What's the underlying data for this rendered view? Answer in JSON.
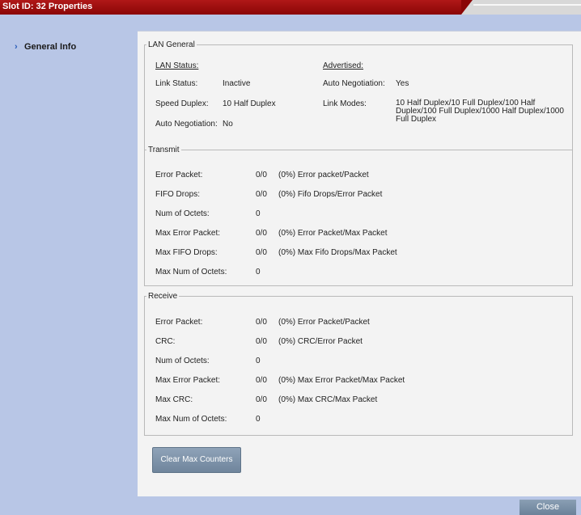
{
  "title": "Slot ID: 32 Properties",
  "nav": {
    "general_info": "General Info"
  },
  "lan_general": {
    "legend": "LAN General",
    "lan_status_header": "LAN Status:",
    "advertised_header": "Advertised:",
    "link_status_label": "Link Status:",
    "link_status_value": "Inactive",
    "speed_duplex_label": "Speed Duplex:",
    "speed_duplex_value": "10 Half Duplex",
    "auto_neg_label": "Auto Negotiation:",
    "auto_neg_value": "No",
    "adv_auto_neg_label": "Auto Negotiation:",
    "adv_auto_neg_value": "Yes",
    "link_modes_label": "Link Modes:",
    "link_modes_value": [
      "10 Half Duplex/10 Full Duplex/100 Half",
      "Duplex/100 Full Duplex/1000 Half Duplex/1000",
      "Full Duplex"
    ]
  },
  "transmit": {
    "legend": "Transmit",
    "rows": [
      {
        "label": "Error Packet:",
        "value": "0/0",
        "note": "(0%) Error packet/Packet"
      },
      {
        "label": "FIFO Drops:",
        "value": "0/0",
        "note": "(0%) Fifo Drops/Error Packet"
      },
      {
        "label": "Num of Octets:",
        "value": "0",
        "note": ""
      },
      {
        "label": "Max Error Packet:",
        "value": "0/0",
        "note": "(0%) Error Packet/Max Packet"
      },
      {
        "label": "Max FIFO Drops:",
        "value": "0/0",
        "note": "(0%) Max Fifo Drops/Max Packet"
      },
      {
        "label": "Max Num of Octets:",
        "value": "0",
        "note": ""
      }
    ]
  },
  "receive": {
    "legend": "Receive",
    "rows": [
      {
        "label": "Error Packet:",
        "value": "0/0",
        "note": "(0%) Error Packet/Packet"
      },
      {
        "label": "CRC:",
        "value": "0/0",
        "note": "(0%) CRC/Error Packet"
      },
      {
        "label": "Num of Octets:",
        "value": "0",
        "note": ""
      },
      {
        "label": "Max Error Packet:",
        "value": "0/0",
        "note": "(0%) Max Error Packet/Max Packet"
      },
      {
        "label": "Max CRC:",
        "value": "0/0",
        "note": "(0%) Max CRC/Max Packet"
      },
      {
        "label": "Max Num of Octets:",
        "value": "0",
        "note": ""
      }
    ]
  },
  "buttons": {
    "clear_max": "Clear Max Counters",
    "close": "Close"
  }
}
